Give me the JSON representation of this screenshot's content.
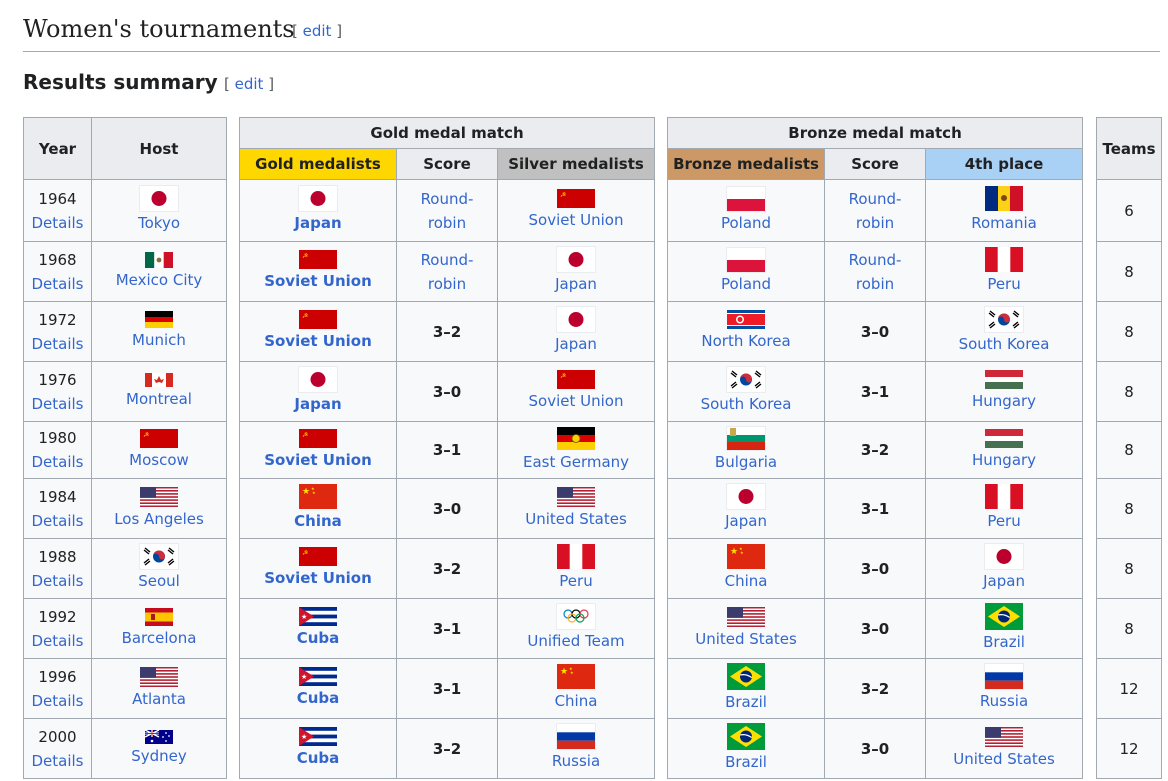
{
  "section": {
    "title": "Women's tournaments",
    "edit": "edit"
  },
  "subsection": {
    "title": "Results summary",
    "edit": "edit"
  },
  "headers": {
    "year": "Year",
    "host": "Host",
    "gold_match": "Gold medal match",
    "bronze_match": "Bronze medal match",
    "teams": "Teams",
    "gold": "Gold medalists",
    "score": "Score",
    "silver": "Silver medalists",
    "bronze": "Bronze medalists",
    "fourth": "4th place"
  },
  "rows": [
    {
      "year": "1964",
      "details": "Details",
      "host": "Tokyo",
      "host_flag": "jp",
      "gold": "Japan",
      "gold_flag": "jp",
      "score1": "Round-robin",
      "silver": "Soviet Union",
      "silver_flag": "su",
      "bronze": "Poland",
      "bronze_flag": "pl",
      "score2": "Round-robin",
      "fourth": "Romania",
      "fourth_flag": "ro",
      "teams": "6"
    },
    {
      "year": "1968",
      "details": "Details",
      "host": "Mexico City",
      "host_flag": "mx",
      "gold": "Soviet Union",
      "gold_flag": "su",
      "score1": "Round-robin",
      "silver": "Japan",
      "silver_flag": "jp",
      "bronze": "Poland",
      "bronze_flag": "pl",
      "score2": "Round-robin",
      "fourth": "Peru",
      "fourth_flag": "pe",
      "teams": "8"
    },
    {
      "year": "1972",
      "details": "Details",
      "host": "Munich",
      "host_flag": "de",
      "gold": "Soviet Union",
      "gold_flag": "su",
      "score1": "3–2",
      "silver": "Japan",
      "silver_flag": "jp",
      "bronze": "North Korea",
      "bronze_flag": "kp",
      "score2": "3–0",
      "fourth": "South Korea",
      "fourth_flag": "kr",
      "teams": "8"
    },
    {
      "year": "1976",
      "details": "Details",
      "host": "Montreal",
      "host_flag": "ca",
      "gold": "Japan",
      "gold_flag": "jp",
      "score1": "3–0",
      "silver": "Soviet Union",
      "silver_flag": "su",
      "bronze": "South Korea",
      "bronze_flag": "kr",
      "score2": "3–1",
      "fourth": "Hungary",
      "fourth_flag": "hu",
      "teams": "8"
    },
    {
      "year": "1980",
      "details": "Details",
      "host": "Moscow",
      "host_flag": "su",
      "gold": "Soviet Union",
      "gold_flag": "su",
      "score1": "3–1",
      "silver": "East Germany",
      "silver_flag": "gdr",
      "bronze": "Bulgaria",
      "bronze_flag": "bg",
      "score2": "3–2",
      "fourth": "Hungary",
      "fourth_flag": "hu",
      "teams": "8"
    },
    {
      "year": "1984",
      "details": "Details",
      "host": "Los Angeles",
      "host_flag": "us",
      "gold": "China",
      "gold_flag": "cn",
      "score1": "3–0",
      "silver": "United States",
      "silver_flag": "us",
      "bronze": "Japan",
      "bronze_flag": "jp",
      "score2": "3–1",
      "fourth": "Peru",
      "fourth_flag": "pe",
      "teams": "8"
    },
    {
      "year": "1988",
      "details": "Details",
      "host": "Seoul",
      "host_flag": "kr",
      "gold": "Soviet Union",
      "gold_flag": "su",
      "score1": "3–2",
      "silver": "Peru",
      "silver_flag": "pe",
      "bronze": "China",
      "bronze_flag": "cn",
      "score2": "3–0",
      "fourth": "Japan",
      "fourth_flag": "jp",
      "teams": "8"
    },
    {
      "year": "1992",
      "details": "Details",
      "host": "Barcelona",
      "host_flag": "es",
      "gold": "Cuba",
      "gold_flag": "cu",
      "score1": "3–1",
      "silver": "Unified Team",
      "silver_flag": "oly",
      "bronze": "United States",
      "bronze_flag": "us",
      "score2": "3–0",
      "fourth": "Brazil",
      "fourth_flag": "br",
      "teams": "8"
    },
    {
      "year": "1996",
      "details": "Details",
      "host": "Atlanta",
      "host_flag": "us",
      "gold": "Cuba",
      "gold_flag": "cu",
      "score1": "3–1",
      "silver": "China",
      "silver_flag": "cn",
      "bronze": "Brazil",
      "bronze_flag": "br",
      "score2": "3–2",
      "fourth": "Russia",
      "fourth_flag": "ru",
      "teams": "12"
    },
    {
      "year": "2000",
      "details": "Details",
      "host": "Sydney",
      "host_flag": "au",
      "gold": "Cuba",
      "gold_flag": "cu",
      "score1": "3–2",
      "silver": "Russia",
      "silver_flag": "ru",
      "bronze": "Brazil",
      "bronze_flag": "br",
      "score2": "3–0",
      "fourth": "United States",
      "fourth_flag": "us",
      "teams": "12"
    }
  ]
}
